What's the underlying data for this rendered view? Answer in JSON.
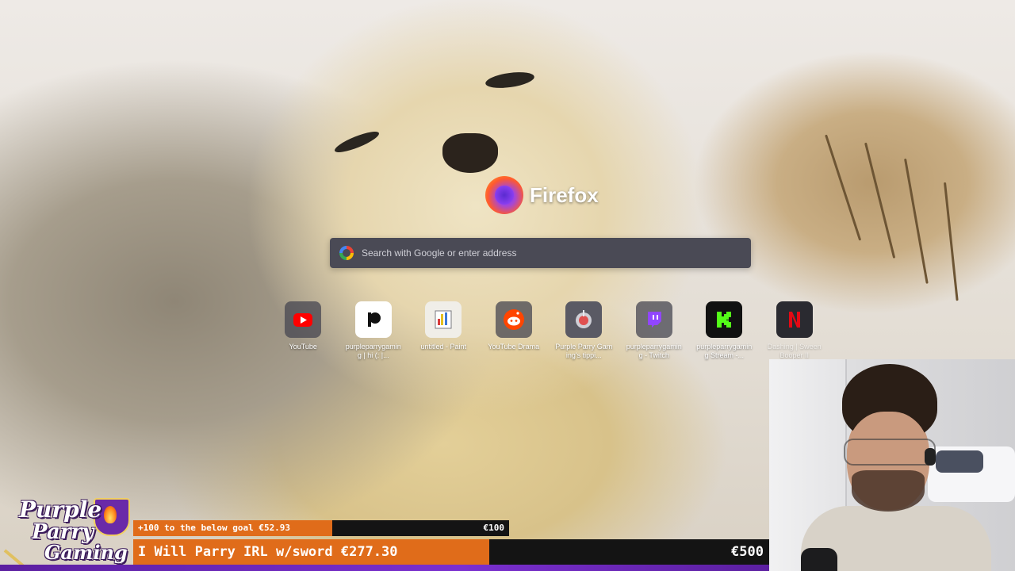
{
  "browser": {
    "brand_name": "Firefox",
    "search": {
      "placeholder": "Search with Google or enter address"
    },
    "shortcuts": [
      {
        "label": "YouTube",
        "icon": "youtube-icon"
      },
      {
        "label": "purpleparrygaming | hi (: |...",
        "icon": "patreon-icon"
      },
      {
        "label": "untitled - Paint",
        "icon": "paint-icon"
      },
      {
        "label": "YouTube Drama",
        "icon": "reddit-icon"
      },
      {
        "label": "Purple Parry Gaming's tippi...",
        "icon": "tipping-icon"
      },
      {
        "label": "purpleparrygaming - Twitch",
        "icon": "twitch-icon"
      },
      {
        "label": "purpleparrygaming Stream -...",
        "icon": "kick-icon"
      },
      {
        "label": "Dashing | Sween Booper II",
        "icon": "netflix-icon"
      }
    ]
  },
  "stream_overlay": {
    "logo": {
      "line1": "Purple",
      "line2": "Parry",
      "line3": "Gaming"
    },
    "goal_bar": {
      "text": "+100 to the below goal €52.93",
      "max": "€100",
      "fraction": 0.53
    },
    "main_bar": {
      "text": "I Will Parry IRL w/sword €277.30",
      "max": "€500",
      "fraction": 0.56
    },
    "colors": {
      "progress_fill": "#e06c1a",
      "bar_bg": "#141414",
      "accent_purple": "#5b1fa0"
    }
  }
}
